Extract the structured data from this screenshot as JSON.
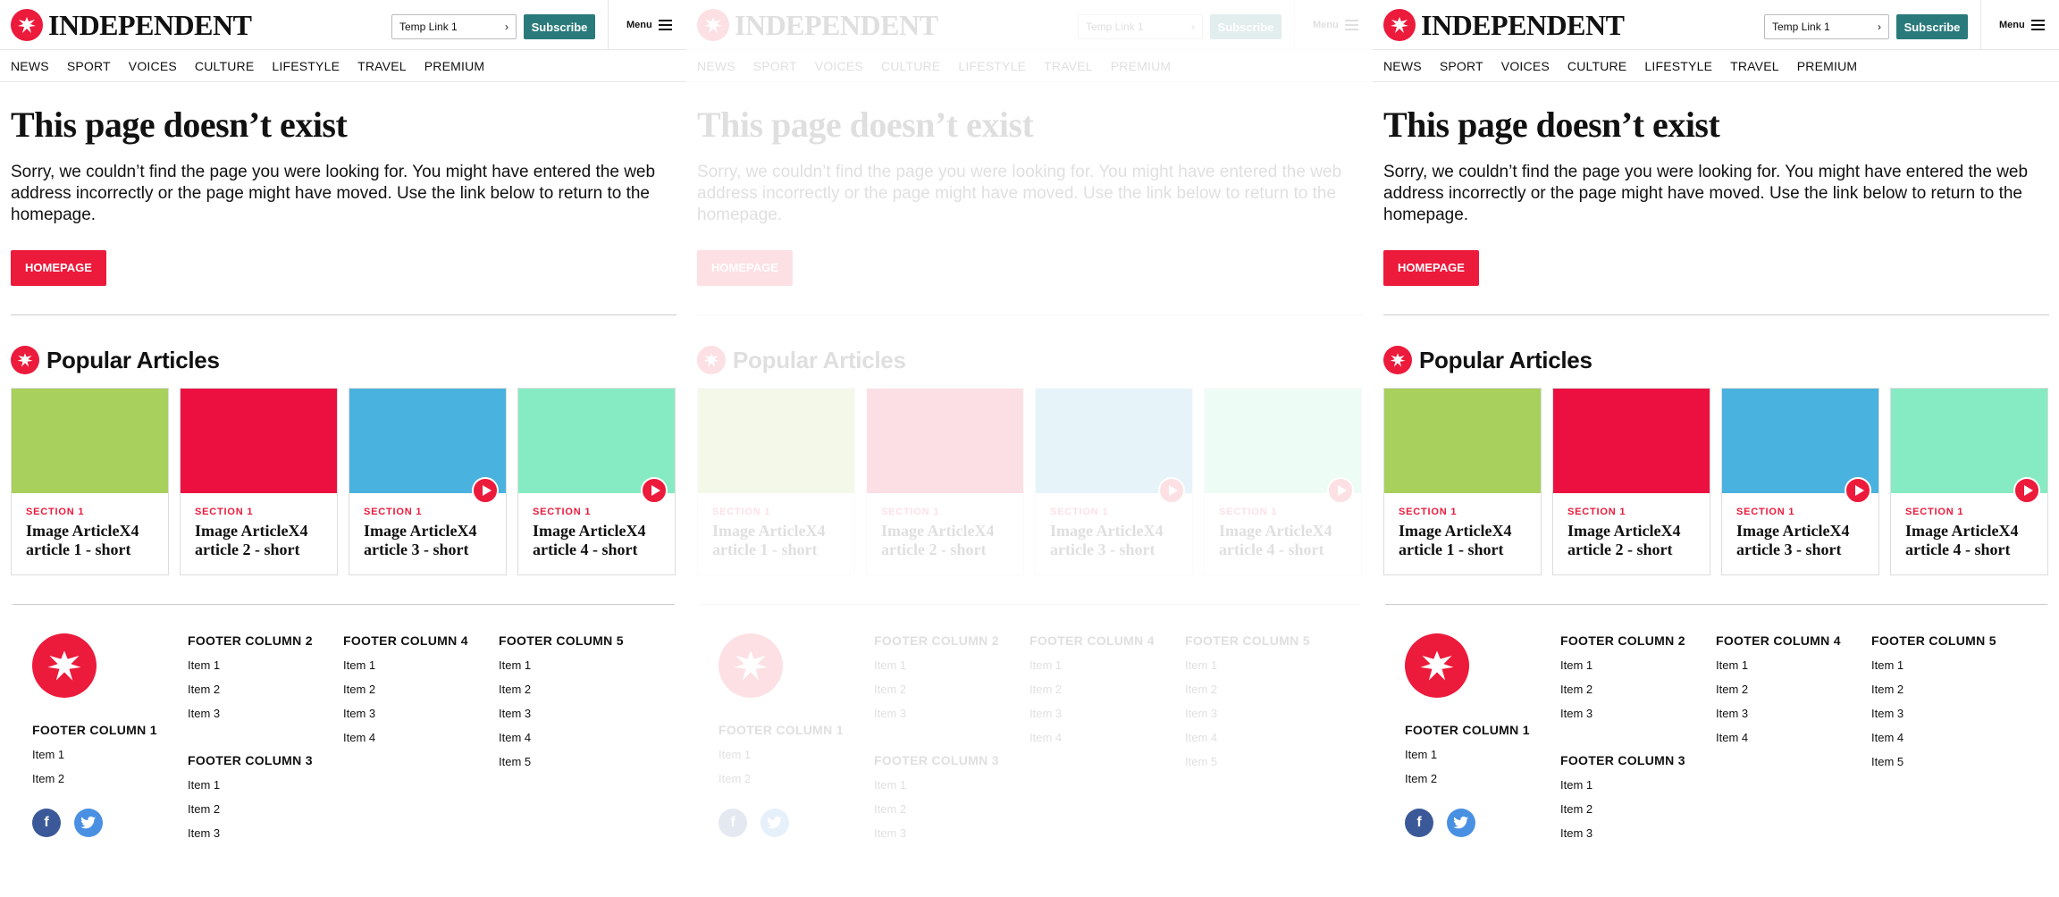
{
  "brand": {
    "name": "INDEPENDENT",
    "accent": "#ec1a3b",
    "teal": "#2a7a7b"
  },
  "header": {
    "temp_link": "Temp Link 1",
    "subscribe": "Subscribe",
    "menu": "Menu"
  },
  "nav": [
    "NEWS",
    "SPORT",
    "VOICES",
    "CULTURE",
    "LIFESTYLE",
    "TRAVEL",
    "PREMIUM"
  ],
  "error": {
    "title": "This page doesn’t exist",
    "message": "Sorry, we couldn’t find the page you were looking for. You might have entered the web address incorrectly or the page might have moved. Use the link below to return to the homepage.",
    "homepage_button": "HOMEPAGE"
  },
  "popular": {
    "title": "Popular Articles",
    "articles": [
      {
        "section": "SECTION 1",
        "title": "Image ArticleX4 article 1 - short",
        "color": "#a8d05c",
        "video": false
      },
      {
        "section": "SECTION 1",
        "title": "Image ArticleX4 article 2 - short",
        "color": "#ec1040",
        "video": false
      },
      {
        "section": "SECTION 1",
        "title": "Image ArticleX4 article 3 - short",
        "color": "#4ab2de",
        "video": true
      },
      {
        "section": "SECTION 1",
        "title": "Image ArticleX4 article 4 - short",
        "color": "#86ebc2",
        "video": true
      }
    ]
  },
  "footer": {
    "col1": {
      "heading": "FOOTER COLUMN 1",
      "items": [
        "Item 1",
        "Item 2"
      ]
    },
    "col2": {
      "heading": "FOOTER COLUMN 2",
      "items": [
        "Item 1",
        "Item 2",
        "Item 3"
      ]
    },
    "col3": {
      "heading": "FOOTER COLUMN 3",
      "items": [
        "Item 1",
        "Item 2",
        "Item 3"
      ]
    },
    "col4": {
      "heading": "FOOTER COLUMN 4",
      "items": [
        "Item 1",
        "Item 2",
        "Item 3",
        "Item 4"
      ]
    },
    "col5": {
      "heading": "FOOTER COLUMN 5",
      "items": [
        "Item 1",
        "Item 2",
        "Item 3",
        "Item 4",
        "Item 5"
      ]
    },
    "social": [
      {
        "icon": "facebook-icon",
        "color": "#3b5998"
      },
      {
        "icon": "twitter-icon",
        "color": "#4a90e2"
      }
    ]
  }
}
